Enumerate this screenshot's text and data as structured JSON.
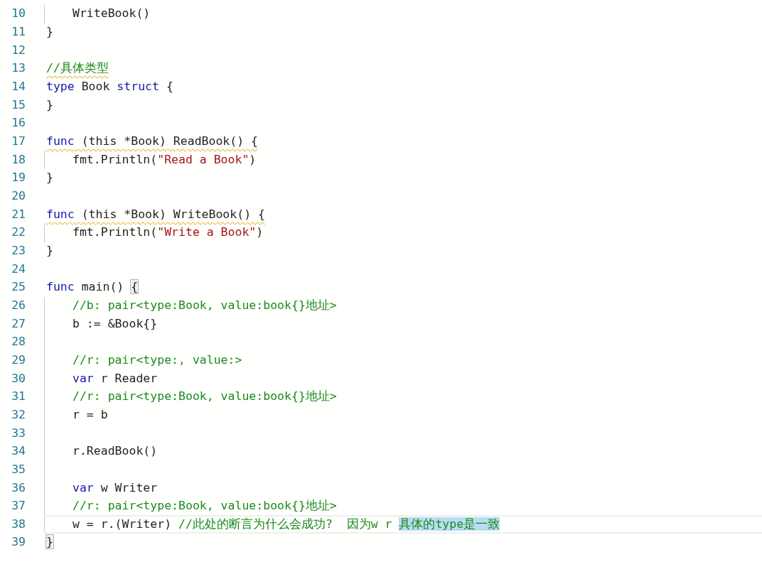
{
  "editor": {
    "lines": [
      {
        "number": "10",
        "indented": true,
        "warning": false,
        "current": false,
        "tokens": [
          {
            "kind": "plain",
            "text": "WriteBook()"
          }
        ]
      },
      {
        "number": "11",
        "indented": false,
        "warning": false,
        "current": false,
        "tokens": [
          {
            "kind": "plain",
            "text": "}"
          }
        ]
      },
      {
        "number": "12",
        "indented": false,
        "warning": false,
        "current": false
      },
      {
        "number": "13",
        "indented": false,
        "warning": true,
        "current": false,
        "tokens": [
          {
            "kind": "comment",
            "text": "//具体类型"
          }
        ]
      },
      {
        "number": "14",
        "indented": false,
        "warning": false,
        "current": false,
        "tokens": [
          {
            "kind": "keyword",
            "text": "type"
          },
          {
            "kind": "plain",
            "text": " Book "
          },
          {
            "kind": "keyword",
            "text": "struct"
          },
          {
            "kind": "plain",
            "text": " {"
          }
        ]
      },
      {
        "number": "15",
        "indented": false,
        "warning": false,
        "current": false,
        "tokens": [
          {
            "kind": "plain",
            "text": "}"
          }
        ]
      },
      {
        "number": "16",
        "indented": false,
        "warning": false,
        "current": false
      },
      {
        "number": "17",
        "indented": false,
        "warning": true,
        "current": false,
        "tokens": [
          {
            "kind": "keyword",
            "text": "func"
          },
          {
            "kind": "plain",
            "text": " (this *Book) ReadBook() {"
          }
        ]
      },
      {
        "number": "18",
        "indented": true,
        "warning": false,
        "current": false,
        "tokens": [
          {
            "kind": "plain",
            "text": "fmt.Println("
          },
          {
            "kind": "string",
            "text": "\"Read a Book\""
          },
          {
            "kind": "plain",
            "text": ")"
          }
        ]
      },
      {
        "number": "19",
        "indented": false,
        "warning": false,
        "current": false,
        "tokens": [
          {
            "kind": "plain",
            "text": "}"
          }
        ]
      },
      {
        "number": "20",
        "indented": false,
        "warning": false,
        "current": false
      },
      {
        "number": "21",
        "indented": false,
        "warning": true,
        "current": false,
        "tokens": [
          {
            "kind": "keyword",
            "text": "func"
          },
          {
            "kind": "plain",
            "text": " (this *Book) WriteBook() {"
          }
        ]
      },
      {
        "number": "22",
        "indented": true,
        "warning": false,
        "current": false,
        "tokens": [
          {
            "kind": "plain",
            "text": "fmt.Println("
          },
          {
            "kind": "string",
            "text": "\"Write a Book\""
          },
          {
            "kind": "plain",
            "text": ")"
          }
        ]
      },
      {
        "number": "23",
        "indented": false,
        "warning": false,
        "current": false,
        "tokens": [
          {
            "kind": "plain",
            "text": "}"
          }
        ]
      },
      {
        "number": "24",
        "indented": false,
        "warning": false,
        "current": false
      },
      {
        "number": "25",
        "indented": false,
        "warning": false,
        "current": false,
        "tokens": [
          {
            "kind": "keyword",
            "text": "func"
          },
          {
            "kind": "plain",
            "text": " main() "
          },
          {
            "kind": "bracket-match",
            "text": "{"
          }
        ]
      },
      {
        "number": "26",
        "indented": true,
        "warning": false,
        "current": false,
        "tokens": [
          {
            "kind": "comment",
            "text": "//b: pair<type:Book, value:book{}地址>"
          }
        ]
      },
      {
        "number": "27",
        "indented": true,
        "warning": false,
        "current": false,
        "tokens": [
          {
            "kind": "plain",
            "text": "b := &Book{}"
          }
        ]
      },
      {
        "number": "28",
        "indented": true,
        "warning": false,
        "current": false
      },
      {
        "number": "29",
        "indented": true,
        "warning": false,
        "current": false,
        "tokens": [
          {
            "kind": "comment",
            "text": "//r: pair<type:, value:>"
          }
        ]
      },
      {
        "number": "30",
        "indented": true,
        "warning": false,
        "current": false,
        "tokens": [
          {
            "kind": "keyword",
            "text": "var"
          },
          {
            "kind": "plain",
            "text": " r Reader"
          }
        ]
      },
      {
        "number": "31",
        "indented": true,
        "warning": false,
        "current": false,
        "tokens": [
          {
            "kind": "comment",
            "text": "//r: pair<type:Book, value:book{}地址>"
          }
        ]
      },
      {
        "number": "32",
        "indented": true,
        "warning": false,
        "current": false,
        "tokens": [
          {
            "kind": "plain",
            "text": "r = b"
          }
        ]
      },
      {
        "number": "33",
        "indented": true,
        "warning": false,
        "current": false
      },
      {
        "number": "34",
        "indented": true,
        "warning": false,
        "current": false,
        "tokens": [
          {
            "kind": "plain",
            "text": "r.ReadBook()"
          }
        ]
      },
      {
        "number": "35",
        "indented": true,
        "warning": false,
        "current": false
      },
      {
        "number": "36",
        "indented": true,
        "warning": false,
        "current": false,
        "tokens": [
          {
            "kind": "keyword",
            "text": "var"
          },
          {
            "kind": "plain",
            "text": " w Writer"
          }
        ]
      },
      {
        "number": "37",
        "indented": true,
        "warning": false,
        "current": false,
        "tokens": [
          {
            "kind": "comment",
            "text": "//r: pair<type:Book, value:book{}地址>"
          }
        ]
      },
      {
        "number": "38",
        "indented": true,
        "warning": false,
        "current": true,
        "tokens": [
          {
            "kind": "plain",
            "text": "w = r.(Writer) "
          },
          {
            "kind": "comment",
            "text": "//此处的断言为什么会成功?  因为w r "
          },
          {
            "kind": "selected-comment",
            "text": "具体的type是一致"
          }
        ]
      },
      {
        "number": "39",
        "indented": false,
        "warning": false,
        "current": false,
        "tokens": [
          {
            "kind": "bracket-match",
            "text": "}"
          }
        ]
      }
    ]
  }
}
